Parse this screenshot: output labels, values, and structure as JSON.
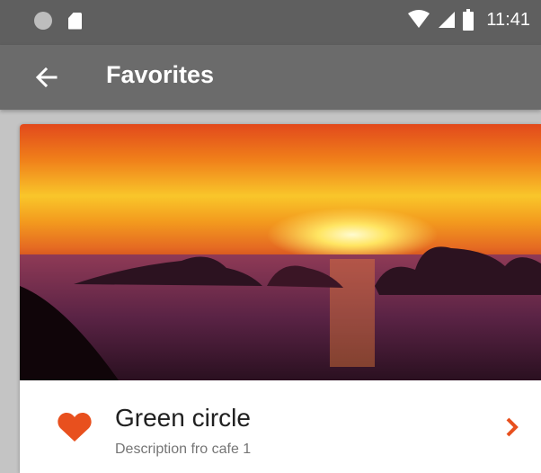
{
  "status_bar": {
    "time": "11:41",
    "icons": [
      "notification-dot-icon",
      "sd-card-icon",
      "wifi-icon",
      "signal-icon",
      "battery-icon"
    ]
  },
  "app_bar": {
    "back_icon": "arrow-left-icon",
    "title": "Favorites"
  },
  "cards": [
    {
      "image": "sunset-over-sea-rocks",
      "favorite_icon": "heart-icon",
      "title": "Green circle",
      "description": "Description fro cafe 1",
      "chevron_icon": "chevron-right-icon"
    }
  ],
  "colors": {
    "status_bar": "#5f5f5f",
    "app_bar": "#6b6b6b",
    "background": "#c4c4c4",
    "accent": "#e8501e"
  }
}
